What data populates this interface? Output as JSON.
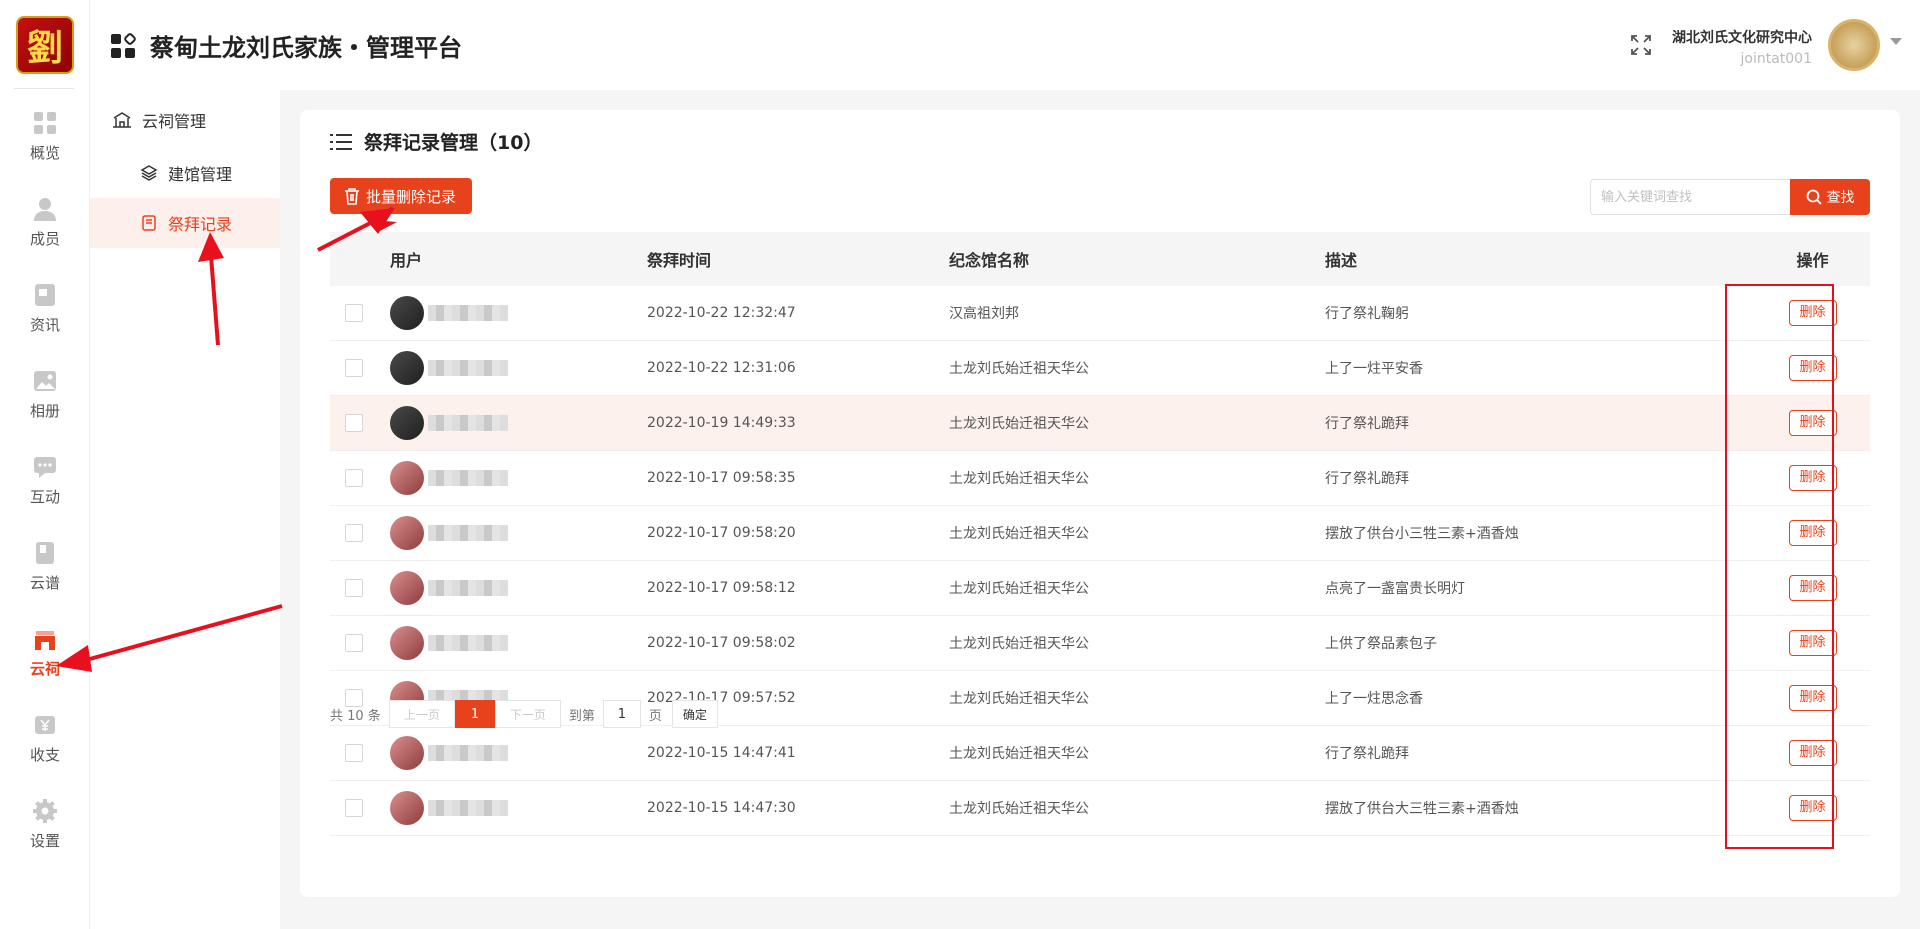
{
  "app": {
    "logo_char": "劉",
    "title": "蔡甸土龙刘氏家族・管理平台",
    "org_name": "湖北刘氏文化研究中心",
    "org_id": "jointat001"
  },
  "rail": {
    "items": [
      {
        "label": "概览",
        "icon": "grid-icon"
      },
      {
        "label": "成员",
        "icon": "person-icon"
      },
      {
        "label": "资讯",
        "icon": "news-icon"
      },
      {
        "label": "相册",
        "icon": "image-icon"
      },
      {
        "label": "互动",
        "icon": "chat-icon"
      },
      {
        "label": "云谱",
        "icon": "book-icon"
      },
      {
        "label": "云祠",
        "icon": "shrine-icon",
        "active": true
      },
      {
        "label": "收支",
        "icon": "yen-icon"
      },
      {
        "label": "设置",
        "icon": "gear-icon"
      }
    ]
  },
  "subnav": {
    "group": "云祠管理",
    "items": [
      {
        "label": "建馆管理"
      },
      {
        "label": "祭拜记录",
        "active": true
      }
    ]
  },
  "card": {
    "title": "祭拜记录管理（10）",
    "batch_delete": "批量删除记录",
    "search_placeholder": "输入关键词查找",
    "search_button": "查找"
  },
  "table": {
    "headers": {
      "user": "用户",
      "time": "祭拜时间",
      "hall": "纪念馆名称",
      "desc": "描述",
      "op": "操作"
    },
    "rows": [
      {
        "time": "2022-10-22 12:32:47",
        "hall": "汉高祖刘邦",
        "desc": "行了祭礼鞠躬",
        "del": "删除"
      },
      {
        "time": "2022-10-22 12:31:06",
        "hall": "土龙刘氏始迁祖天华公",
        "desc": "上了一炷平安香",
        "del": "删除"
      },
      {
        "time": "2022-10-19 14:49:33",
        "hall": "土龙刘氏始迁祖天华公",
        "desc": "行了祭礼跪拜",
        "del": "删除"
      },
      {
        "time": "2022-10-17 09:58:35",
        "hall": "土龙刘氏始迁祖天华公",
        "desc": "行了祭礼跪拜",
        "del": "删除"
      },
      {
        "time": "2022-10-17 09:58:20",
        "hall": "土龙刘氏始迁祖天华公",
        "desc": "摆放了供台小三牲三素+酒香烛",
        "del": "删除"
      },
      {
        "time": "2022-10-17 09:58:12",
        "hall": "土龙刘氏始迁祖天华公",
        "desc": "点亮了一盏富贵长明灯",
        "del": "删除"
      },
      {
        "time": "2022-10-17 09:58:02",
        "hall": "土龙刘氏始迁祖天华公",
        "desc": "上供了祭品素包子",
        "del": "删除"
      },
      {
        "time": "2022-10-17 09:57:52",
        "hall": "土龙刘氏始迁祖天华公",
        "desc": "上了一炷思念香",
        "del": "删除"
      },
      {
        "time": "2022-10-15 14:47:41",
        "hall": "土龙刘氏始迁祖天华公",
        "desc": "行了祭礼跪拜",
        "del": "删除"
      },
      {
        "time": "2022-10-15 14:47:30",
        "hall": "土龙刘氏始迁祖天华公",
        "desc": "摆放了供台大三牲三素+酒香烛",
        "del": "删除"
      }
    ]
  },
  "pager": {
    "total": "共 10 条",
    "prev": "上一页",
    "current": "1",
    "next": "下一页",
    "goto": "到第",
    "goto_value": "1",
    "page_unit": "页",
    "confirm": "确定"
  },
  "colors": {
    "accent": "#e8421c",
    "annotation": "#e0101c"
  }
}
